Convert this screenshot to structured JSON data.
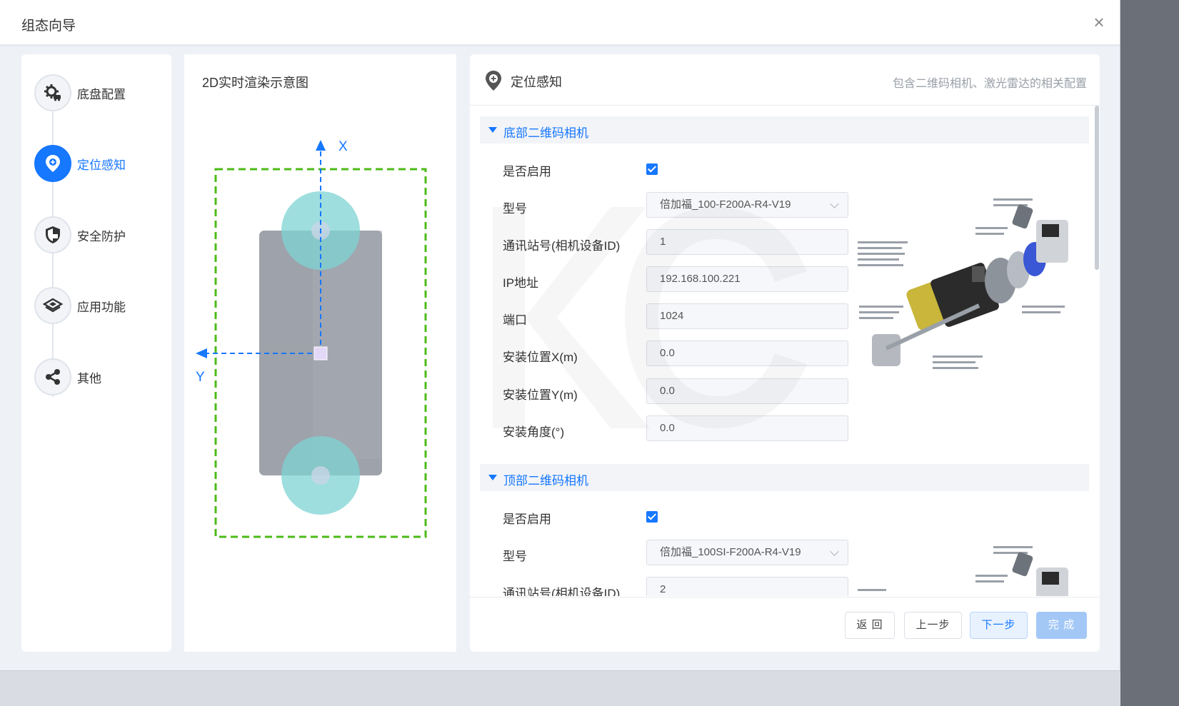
{
  "dialog": {
    "title": "组态向导"
  },
  "steps": [
    {
      "label": "底盘配置",
      "icon": "gear-car-icon"
    },
    {
      "label": "定位感知",
      "icon": "location-icon"
    },
    {
      "label": "安全防护",
      "icon": "shield-icon"
    },
    {
      "label": "应用功能",
      "icon": "layers-icon"
    },
    {
      "label": "其他",
      "icon": "share-icon"
    }
  ],
  "active_step": "定位感知",
  "preview": {
    "title": "2D实时渲染示意图",
    "axis_x": "X",
    "axis_y": "Y"
  },
  "panel": {
    "title": "定位感知",
    "description": "包含二维码相机、激光雷达的相关配置",
    "sections": [
      {
        "title": "底部二维码相机",
        "enabled_label": "是否启用",
        "enabled": true,
        "fields": [
          {
            "label": "型号",
            "value": "倍加福_100-F200A-R4-V19"
          },
          {
            "label": "通讯站号(相机设备ID)",
            "value": "1"
          },
          {
            "label": "IP地址",
            "value": "192.168.100.221"
          },
          {
            "label": "端口",
            "value": "1024"
          },
          {
            "label": "安装位置X(m)",
            "value": "0.0"
          },
          {
            "label": "安装位置Y(m)",
            "value": "0.0"
          },
          {
            "label": "安装角度(°)",
            "value": "0.0"
          }
        ]
      },
      {
        "title": "顶部二维码相机",
        "enabled_label": "是否启用",
        "enabled": true,
        "fields": [
          {
            "label": "型号",
            "value": "倍加福_100SI-F200A-R4-V19"
          },
          {
            "label": "通讯站号(相机设备ID)",
            "value": "2"
          }
        ]
      }
    ]
  },
  "footer": {
    "back": "返 回",
    "prev": "上一步",
    "next": "下一步",
    "done": "完 成"
  },
  "colors": {
    "primary": "#1677ff",
    "footprint": "#4cbb17",
    "wheel": "#7dd3d3",
    "body": "#9ea2ab"
  }
}
